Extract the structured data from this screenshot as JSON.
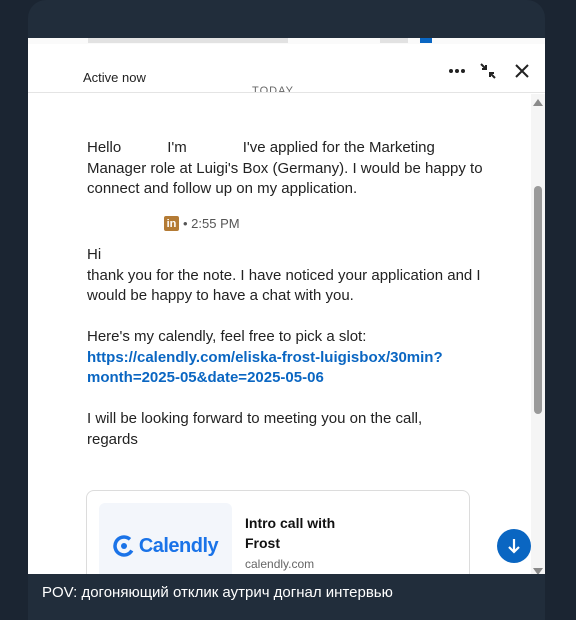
{
  "chat": {
    "status": "Active now",
    "date_divider": "TODAY"
  },
  "messages": {
    "first": {
      "greeting": "Hello",
      "intro": "I'm",
      "text": "I've applied for the Marketing Manager role at Luigi's Box (Germany). I would be happy to connect and follow up on my application."
    },
    "reply": {
      "badge": "in",
      "time": "• 2:55 PM",
      "line1": "Hi",
      "line2": "thank you for the note. I have noticed your application and I would be happy to have a chat with you.",
      "line3": "Here's my calendly, feel free to pick a slot:",
      "link_part1": "https://calendly.com/eliska-frost-luigisbox/30min?",
      "link_part2": "month=2025-05&date=2025-05-06",
      "line4": "I will be looking forward to meeting you on the call,",
      "line5": "regards"
    }
  },
  "link_preview": {
    "logo_text": "Calendly",
    "title_line1": "Intro call with",
    "title_line2": "Frost",
    "domain": "calendly.com"
  },
  "caption": "POV: догоняющий отклик аутрич догнал интервью",
  "colors": {
    "accent": "#0a66c2",
    "linkedin_badge": "#b47b35",
    "frame": "#212d3b"
  }
}
